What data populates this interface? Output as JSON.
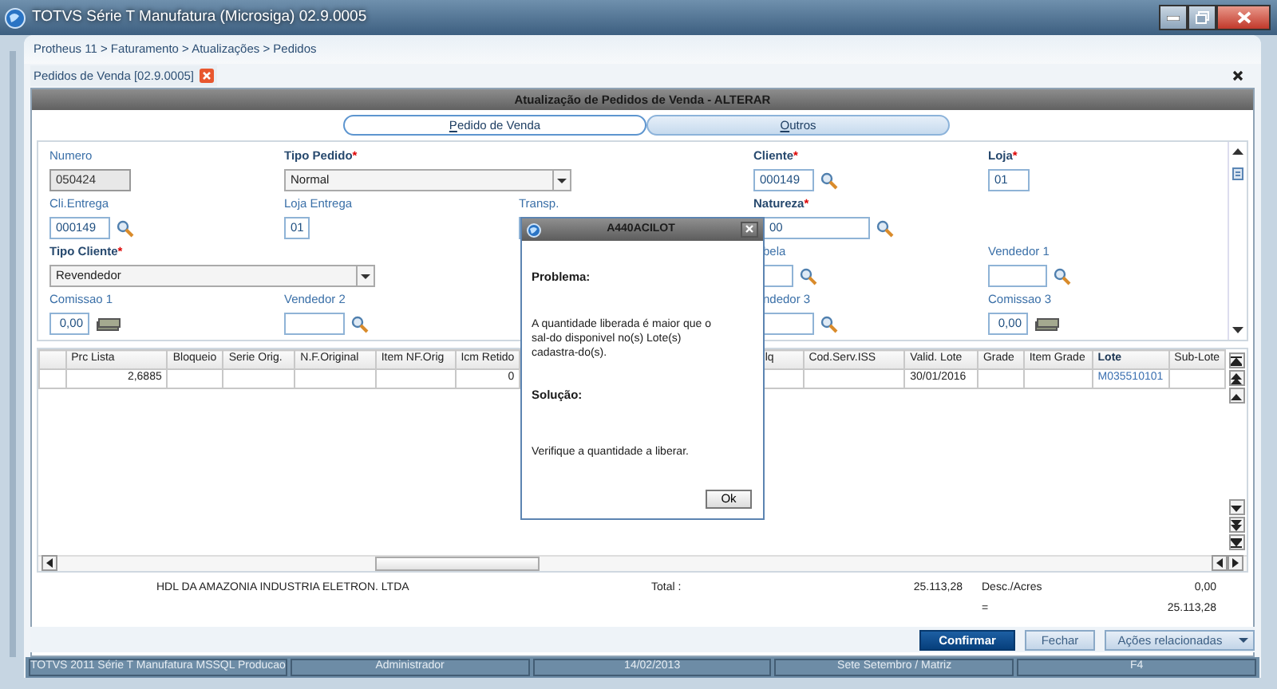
{
  "window": {
    "title": "TOTVS Série T Manufatura (Microsiga) 02.9.0005"
  },
  "breadcrumb": "Protheus 11 > Faturamento > Atualizações > Pedidos",
  "doc_tab": {
    "label": "Pedidos de Venda [02.9.0005]"
  },
  "header": "Atualização de Pedidos de Venda - ALTERAR",
  "tabs": [
    {
      "label": "Pedido de Venda",
      "selected": true
    },
    {
      "label": "Outros",
      "selected": false
    }
  ],
  "form": {
    "fields": [
      {
        "kind": "text",
        "label": "Numero",
        "required": false,
        "value": "050424",
        "disabled": true
      },
      {
        "kind": "select",
        "label": "Tipo Pedido",
        "required": true,
        "required_mark": "*",
        "value": "Normal",
        "disabled": false
      },
      {
        "kind": "lookup",
        "label": "Cliente",
        "required": true,
        "required_mark": "*",
        "value": "000149",
        "disabled": false
      },
      {
        "kind": "text",
        "label": "Loja",
        "required": true,
        "required_mark": "*",
        "value": "01",
        "disabled": false
      },
      {
        "kind": "lookup",
        "label": "Cli.Entrega",
        "required": false,
        "value": "000149",
        "disabled": false
      },
      {
        "kind": "text",
        "label": "Loja Entrega",
        "required": false,
        "value": "01",
        "disabled": false
      },
      {
        "kind": "text",
        "label": "Transp.",
        "required": false,
        "disabled": false
      },
      {
        "kind": "lookup",
        "label": "Natureza",
        "required": true,
        "required_mark": "*",
        "value": "00",
        "disabled": false
      },
      {
        "kind": "select",
        "label": "Tipo Cliente",
        "required": true,
        "required_mark": "*",
        "value": "Revendedor",
        "disabled": false
      },
      {
        "kind": "lookup",
        "label": "bela",
        "required": false,
        "disabled": false
      },
      {
        "kind": "lookup",
        "label": "Vendedor 1",
        "required": false,
        "disabled": false
      },
      {
        "kind": "money",
        "label": "Comissao 1",
        "required": false,
        "value": "0,00",
        "disabled": false
      },
      {
        "kind": "lookup",
        "label": "Vendedor 2",
        "required": false,
        "disabled": false
      },
      {
        "kind": "lookup",
        "label": "ndedor 3",
        "required": false,
        "disabled": false
      },
      {
        "kind": "money",
        "label": "Comissao 3",
        "required": false,
        "value": "0,00",
        "disabled": false
      }
    ]
  },
  "grid": {
    "columns": [
      {
        "label": "Prc Lista",
        "highlighted": false
      },
      {
        "label": "Bloqueio",
        "highlighted": false
      },
      {
        "label": "Serie Orig.",
        "highlighted": false
      },
      {
        "label": "N.F.Original",
        "highlighted": false
      },
      {
        "label": "Item NF.Orig",
        "highlighted": false
      },
      {
        "label": "Icm Retido",
        "highlighted": false
      },
      {
        "label": "lq",
        "highlighted": false
      },
      {
        "label": "Cod.Serv.ISS",
        "highlighted": false
      },
      {
        "label": "Valid. Lote",
        "highlighted": false
      },
      {
        "label": "Grade",
        "highlighted": false
      },
      {
        "label": "Item Grade",
        "highlighted": false
      },
      {
        "label": "Lote",
        "highlighted": true
      },
      {
        "label": "Sub-Lote",
        "highlighted": false
      }
    ],
    "rows": [
      {
        "cells": [
          "2,6885",
          null,
          null,
          null,
          null,
          "0",
          null,
          null,
          "30/01/2016",
          null,
          null,
          "M035510101",
          null
        ]
      }
    ]
  },
  "totals": {
    "company": "HDL DA AMAZONIA INDUSTRIA ELETRON. LTDA",
    "total_label": "Total :",
    "total": "25.113,28",
    "discount_label": "Desc./Acres",
    "discount": "0,00",
    "equals": "=",
    "net": "25.113,28"
  },
  "buttons": [
    {
      "label": "Confirmar",
      "primary": true,
      "dropdown": false
    },
    {
      "label": "Fechar",
      "primary": false,
      "dropdown": false
    },
    {
      "label": "Ações relacionadas",
      "primary": false,
      "dropdown": true
    }
  ],
  "status_bar": [
    "TOTVS 2011 Série T Manufatura MSSQL Producao",
    "Administrador",
    "14/02/2013",
    "Sete Setembro / Matriz",
    "F4"
  ],
  "dialog": {
    "title": "A440ACILOT",
    "problem_heading": "Problema:",
    "problem_lines": [
      "A quantidade liberada é maior que o",
      "sal-do disponivel  no(s)  Lote(s)",
      "cadastra-do(s)."
    ],
    "solution_heading": "Solução:",
    "solution": "Verifique a quantidade a liberar.",
    "button": "Ok"
  }
}
